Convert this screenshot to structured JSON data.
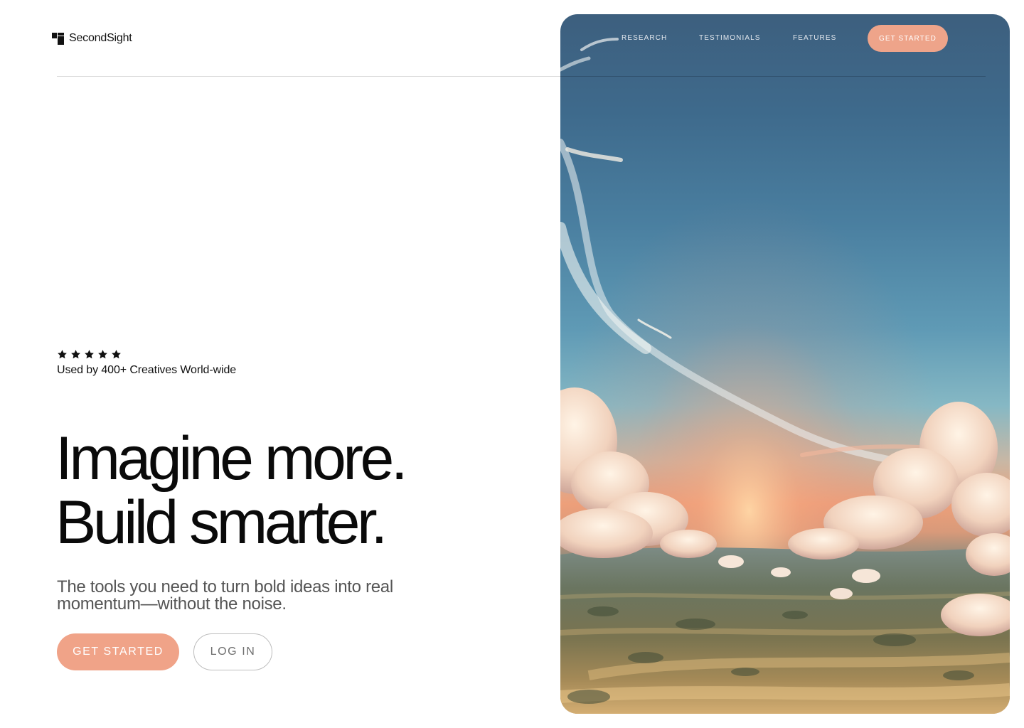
{
  "brand": {
    "name": "SecondSight",
    "logo_icon": "secondsight-logo-icon"
  },
  "nav": {
    "items": [
      {
        "label": "RESEARCH"
      },
      {
        "label": "TESTIMONIALS"
      },
      {
        "label": "FEATURES"
      }
    ],
    "cta_label": "GET STARTED"
  },
  "social_proof": {
    "rating": 5,
    "max_rating": 5,
    "text": "Used by 400+ Creatives World-wide"
  },
  "hero": {
    "headline_line1": "Imagine more.",
    "headline_line2": "Build smarter.",
    "subcopy": "The tools you need to turn bold ideas into real momentum—without the noise.",
    "primary_cta": "GET STARTED",
    "secondary_cta": "LOG IN",
    "image_subject": "painted sky with clouds at sunset over patchwork farmland"
  },
  "colors": {
    "accent": "#f0a388",
    "text_primary": "#0a0a0a",
    "text_muted": "#555555",
    "divider": "#dcdcdc"
  }
}
